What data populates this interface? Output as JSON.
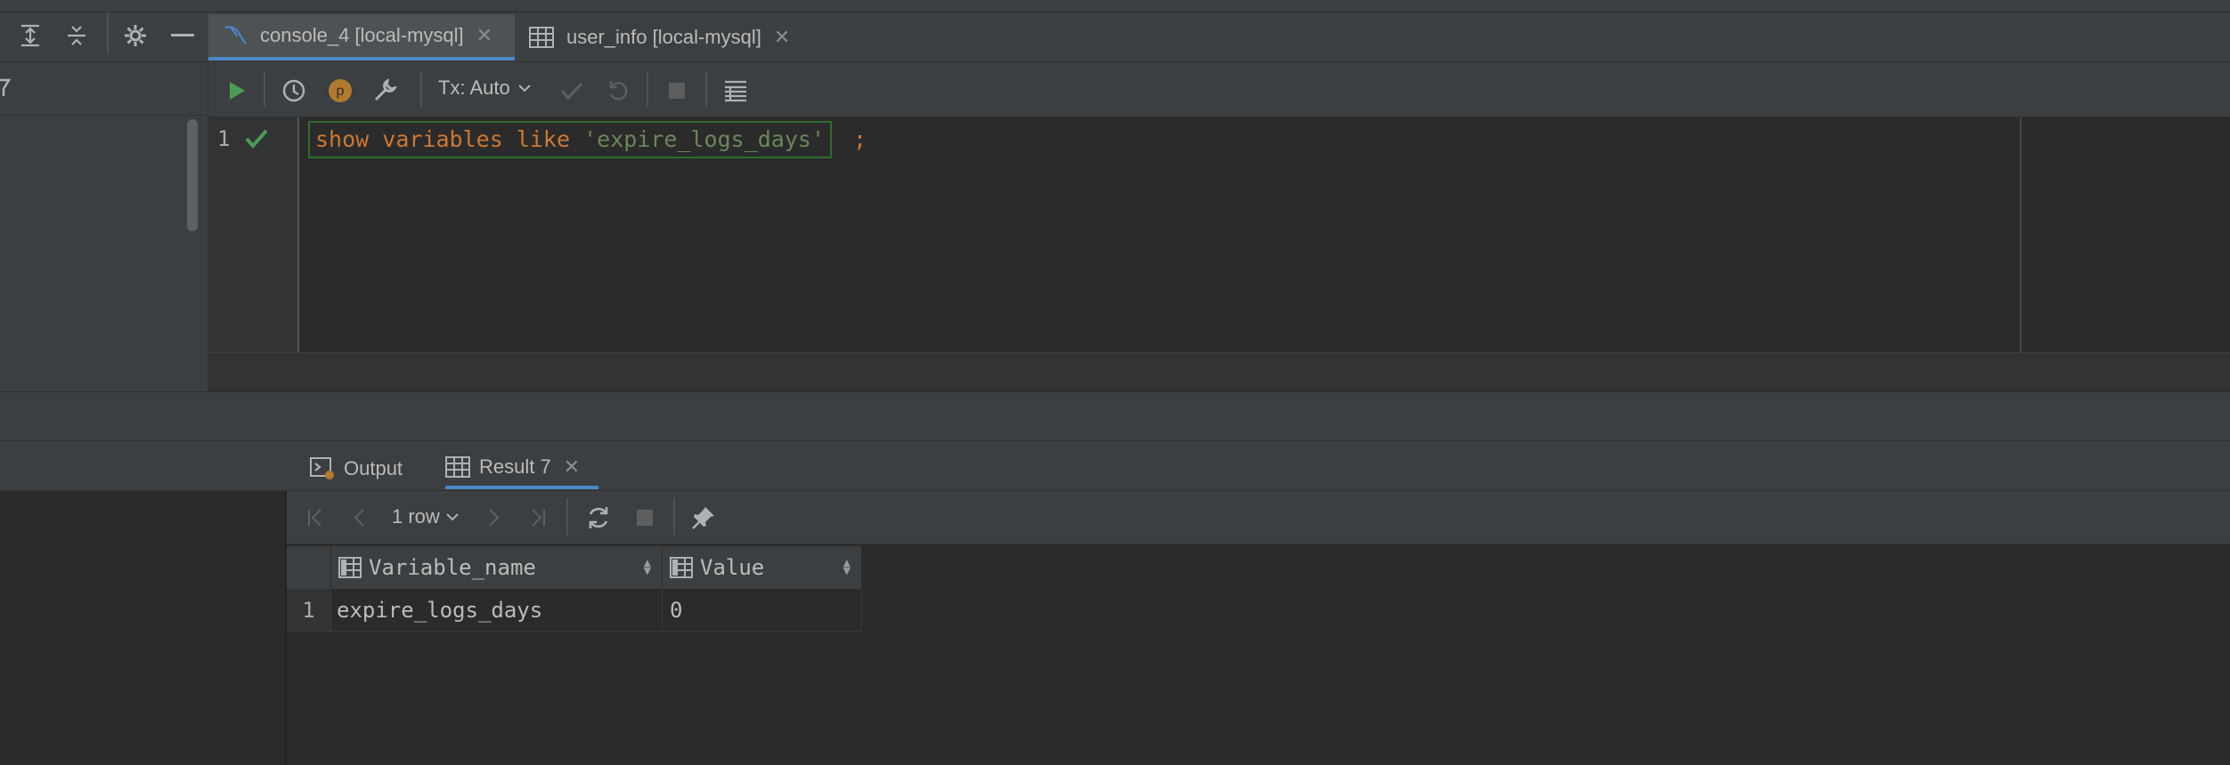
{
  "editor_tabs": [
    {
      "label": "console_4 [local-mysql]",
      "icon": "mysql-dolphin-icon"
    },
    {
      "label": "user_info [local-mysql]",
      "icon": "table-icon"
    }
  ],
  "toolbar": {
    "tx_mode": "Tx: Auto"
  },
  "editor": {
    "line_number": "1",
    "code": {
      "kw1": "show",
      "kw2": "variables",
      "kw3": "like",
      "literal": "'expire_logs_days'",
      "terminator": ";"
    }
  },
  "results": {
    "tabs": [
      {
        "label": "Output"
      },
      {
        "label": "Result 7"
      }
    ],
    "row_count": "1 row",
    "columns": [
      "Variable_name",
      "Value"
    ],
    "rows": [
      {
        "num": "1",
        "cells": [
          "expire_logs_days",
          "0"
        ]
      }
    ]
  },
  "colors": {
    "accent": "#4a88c7",
    "keyword": "#cc7832",
    "string": "#6a8759",
    "run_green": "#499c54",
    "p_badge": "#b07a2f"
  }
}
